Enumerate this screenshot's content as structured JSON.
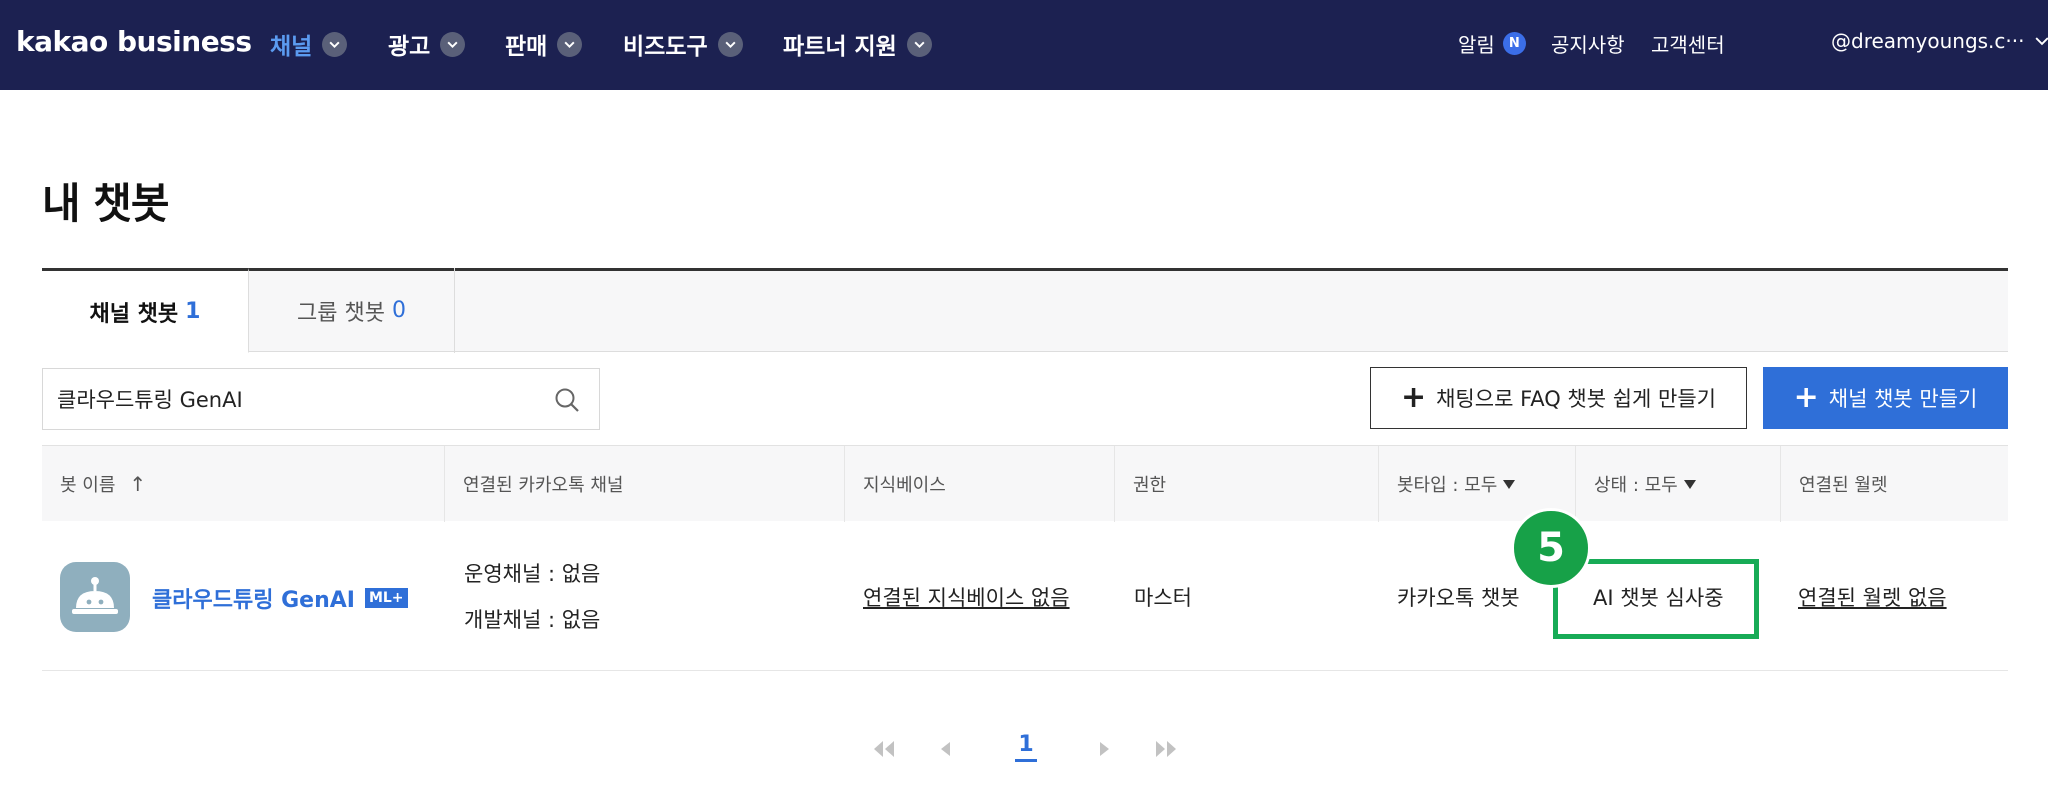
{
  "header": {
    "logo": "kakao business",
    "nav": [
      {
        "label": "채널",
        "active": true
      },
      {
        "label": "광고",
        "active": false
      },
      {
        "label": "판매",
        "active": false
      },
      {
        "label": "비즈도구",
        "active": false
      },
      {
        "label": "파트너 지원",
        "active": false
      }
    ],
    "alerts_label": "알림",
    "alerts_badge": "N",
    "notice_label": "공지사항",
    "support_label": "고객센터",
    "account": "@dreamyoungs.c···"
  },
  "page": {
    "title": "내 챗봇",
    "tabs": [
      {
        "label": "채널 챗봇",
        "count": "1",
        "active": true
      },
      {
        "label": "그룹 챗봇",
        "count": "0",
        "active": false
      }
    ],
    "search_value": "클라우드튜링 GenAI",
    "faq_button_label": "채팅으로 FAQ 챗봇 쉽게 만들기",
    "create_button_label": "채널 챗봇 만들기"
  },
  "table": {
    "headers": {
      "bot_name": "봇 이름",
      "channel": "연결된 카카오톡 채널",
      "kb": "지식베이스",
      "role": "권한",
      "bot_type": "봇타입 : 모두",
      "status": "상태 : 모두",
      "wallet": "연결된 월렛"
    },
    "rows": [
      {
        "name": "클라우드튜링 GenAI",
        "badge": "ML+",
        "op_channel": "운영채널 : 없음",
        "dev_channel": "개발채널 : 없음",
        "kb": "연결된 지식베이스 없음",
        "role": "마스터",
        "bot_type": "카카오톡 챗봇",
        "status": "AI 챗봇 심사중",
        "wallet": "연결된 월렛 없음"
      }
    ]
  },
  "annotation": {
    "step": "5",
    "color": "#17ab56"
  },
  "pagination": {
    "current": "1"
  },
  "colors": {
    "nav_bg": "#1c2151",
    "primary": "#2f6fd8",
    "highlight": "#17ab56"
  }
}
